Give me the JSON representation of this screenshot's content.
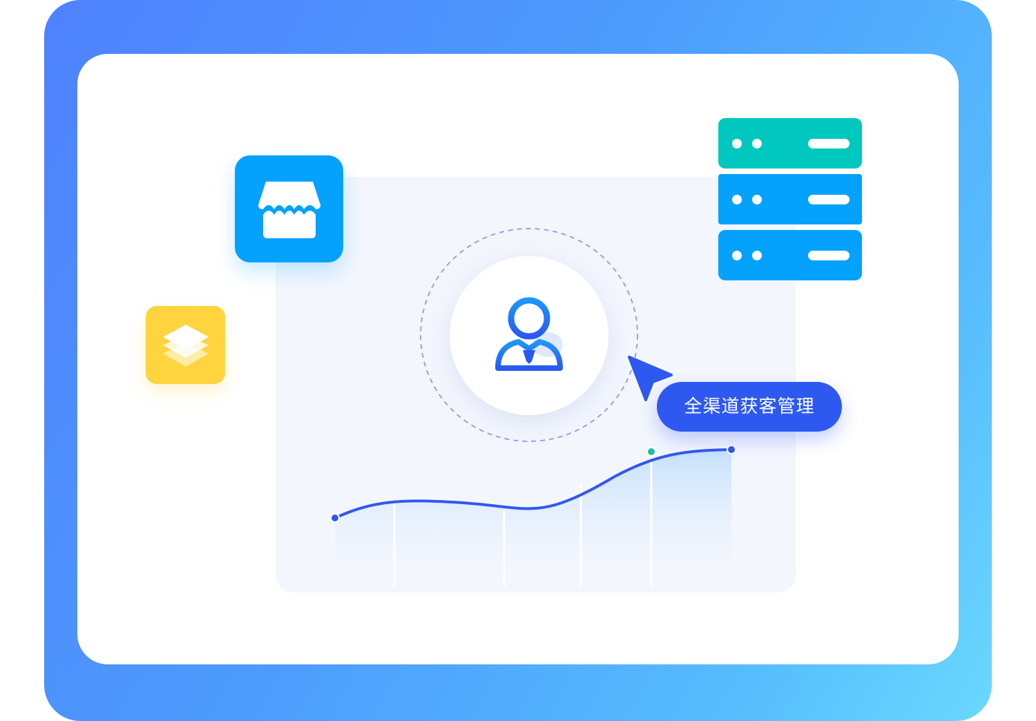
{
  "label": {
    "text": "全渠道获客管理"
  },
  "icons": {
    "store": "store-icon",
    "layers": "layers-icon",
    "server": "server-icon",
    "user": "user-icon",
    "cursor": "cursor-icon"
  },
  "colors": {
    "frame_start": "#4e81fe",
    "frame_end": "#6ad8fe",
    "store_app": "#05a2fd",
    "layers_app": "#ffd43f",
    "server_top": "#00c8be",
    "server_rows": "#05a2fd",
    "accent": "#2e59f1",
    "line": "#3357ee",
    "marker_highlight": "#19c1a5"
  }
}
